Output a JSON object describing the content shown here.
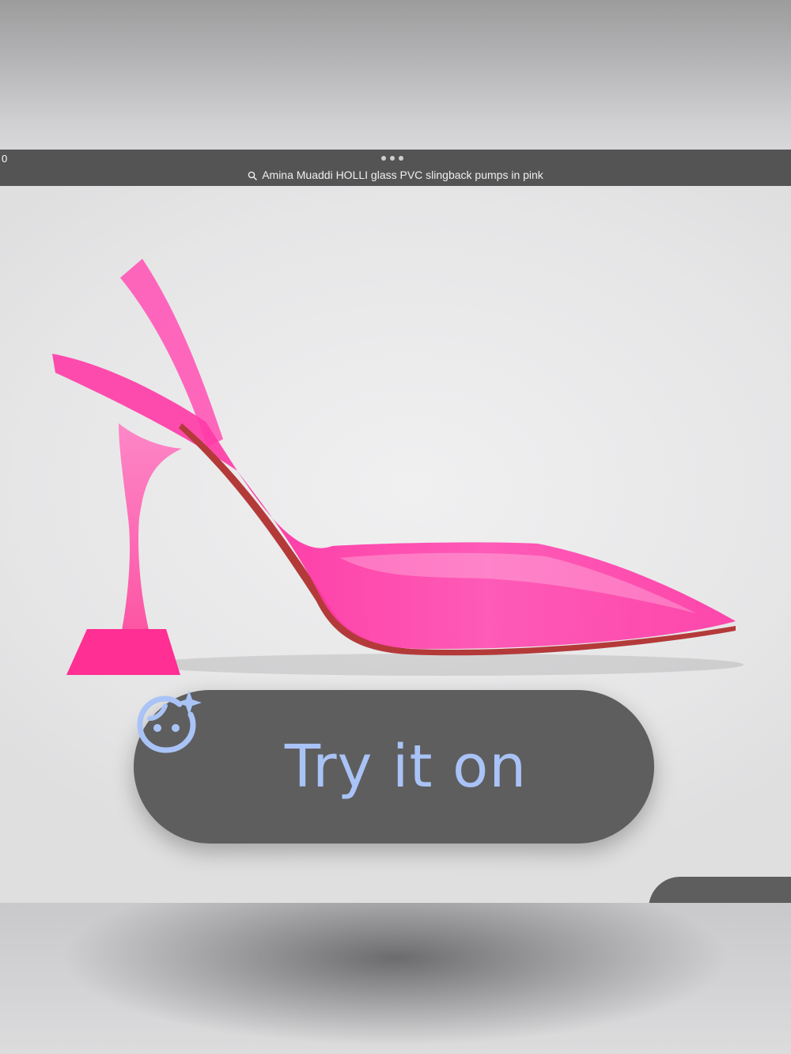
{
  "viewer": {
    "counter": "0",
    "search_query": "Amina Muaddi HOLLI glass PVC slingback pumps in pink"
  },
  "image": {
    "subject_icon": "pink-slingback-pump-image"
  },
  "try_on_button": {
    "label": "Try it on",
    "icon": "face-sparkle-icon",
    "text_color": "#a9c3f6",
    "background": "#5e5e5f"
  },
  "colors": {
    "shoe_pink": "#ff3aa6",
    "sole_red": "#b43a3a",
    "search_bar": "#545454"
  }
}
